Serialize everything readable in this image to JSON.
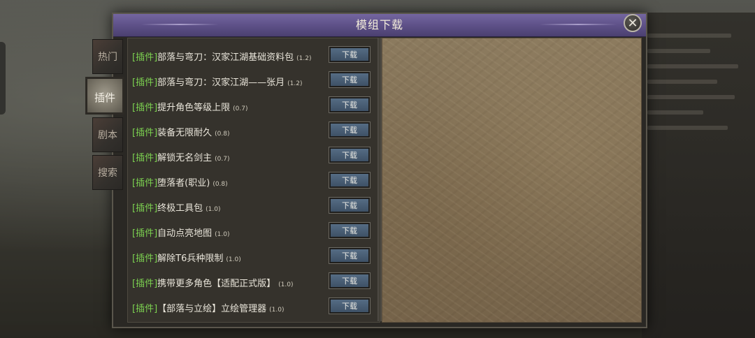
{
  "dialog": {
    "title": "模组下载",
    "close_symbol": "✕"
  },
  "tabs": [
    {
      "label": "热门",
      "active": false
    },
    {
      "label": "插件",
      "active": true
    },
    {
      "label": "剧本",
      "active": false
    },
    {
      "label": "搜索",
      "active": false
    }
  ],
  "mods": [
    {
      "tag": "[插件]",
      "name": "部落与弯刀：汉家江湖基础资料包",
      "version": "(1.2)",
      "button": "下载"
    },
    {
      "tag": "[插件]",
      "name": "部落与弯刀：汉家江湖——张月",
      "version": "(1.2)",
      "button": "下载"
    },
    {
      "tag": "[插件]",
      "name": "提升角色等级上限",
      "version": "(0.7)",
      "button": "下载"
    },
    {
      "tag": "[插件]",
      "name": "装备无限耐久",
      "version": "(0.8)",
      "button": "下载"
    },
    {
      "tag": "[插件]",
      "name": "解锁无名剑主",
      "version": "(0.7)",
      "button": "下载"
    },
    {
      "tag": "[插件]",
      "name": "堕落者(职业)",
      "version": "(0.8)",
      "button": "下载"
    },
    {
      "tag": "[插件]",
      "name": "终极工具包",
      "version": "(1.0)",
      "button": "下载"
    },
    {
      "tag": "[插件]",
      "name": "自动点亮地图",
      "version": "(1.0)",
      "button": "下载"
    },
    {
      "tag": "[插件]",
      "name": "解除T6兵种限制",
      "version": "(1.0)",
      "button": "下载"
    },
    {
      "tag": "[插件]",
      "name": "携带更多角色【适配正式版】",
      "version": "(1.0)",
      "button": "下载"
    },
    {
      "tag": "[插件]",
      "name": "【部落与立绘】立绘管理器",
      "version": "(1.0)",
      "button": "下载"
    }
  ],
  "colors": {
    "title_bar": "#5c4f86",
    "tag_green": "#7cd150",
    "download_button": "#4a5f76",
    "preview_parchment": "#7f6d52"
  }
}
